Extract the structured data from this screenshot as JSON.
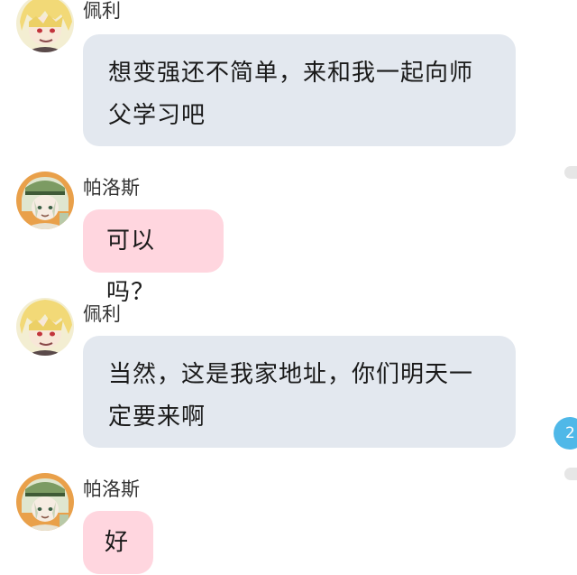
{
  "messages": [
    {
      "sender": "佩利",
      "avatar_icon": "blonde-character-avatar",
      "bubble_color": "#e3e8ef",
      "lines": [
        "想变强还不简单，来和我一起向师",
        "父学习吧"
      ]
    },
    {
      "sender": "帕洛斯",
      "avatar_icon": "green-hat-character-avatar",
      "bubble_color": "#ffd6df",
      "lines": [
        "可以吗？"
      ]
    },
    {
      "sender": "佩利",
      "avatar_icon": "blonde-character-avatar",
      "bubble_color": "#e3e8ef",
      "lines": [
        "当然，这是我家地址，你们明天一",
        "定要来啊"
      ]
    },
    {
      "sender": "帕洛斯",
      "avatar_icon": "green-hat-character-avatar",
      "bubble_color": "#ffd6df",
      "lines": [
        "好"
      ]
    }
  ],
  "unread_badge": "2",
  "colors": {
    "gray_bubble": "#e3e8ef",
    "pink_bubble": "#ffd6df",
    "badge": "#4fb8e8"
  }
}
